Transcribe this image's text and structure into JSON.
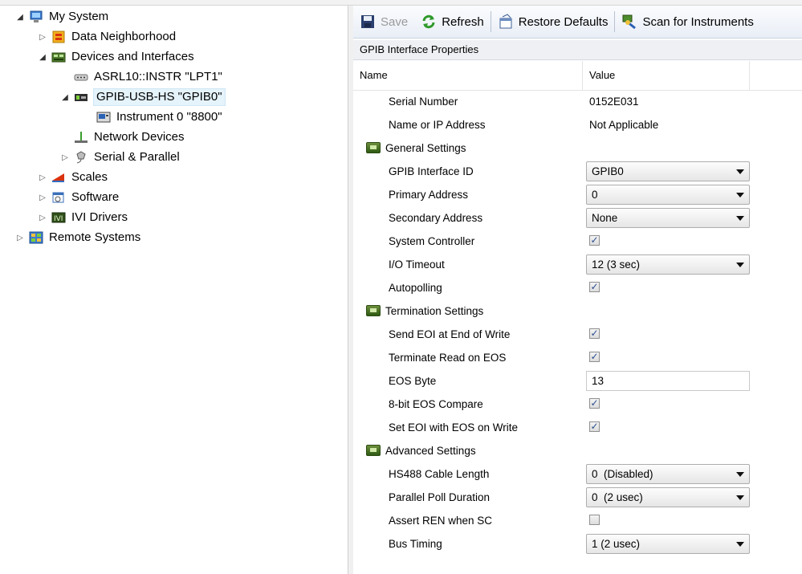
{
  "tree": {
    "nodes": [
      {
        "label": "My System",
        "arrow": "open",
        "icon": "computer-icon"
      },
      {
        "label": "Data Neighborhood",
        "arrow": "closed",
        "icon": "data-neighborhood-icon"
      },
      {
        "label": "Devices and Interfaces",
        "arrow": "open",
        "icon": "devices-icon"
      },
      {
        "label": "ASRL10::INSTR \"LPT1\"",
        "arrow": "none",
        "icon": "port-icon"
      },
      {
        "label": "GPIB-USB-HS \"GPIB0\"",
        "arrow": "open",
        "icon": "gpib-icon"
      },
      {
        "label": "Instrument 0 \"8800\"",
        "arrow": "none",
        "icon": "instrument-icon"
      },
      {
        "label": "Network Devices",
        "arrow": "none",
        "icon": "network-devices-icon"
      },
      {
        "label": "Serial & Parallel",
        "arrow": "closed",
        "icon": "serial-parallel-icon"
      },
      {
        "label": "Scales",
        "arrow": "closed",
        "icon": "scales-icon"
      },
      {
        "label": "Software",
        "arrow": "closed",
        "icon": "software-icon"
      },
      {
        "label": "IVI Drivers",
        "arrow": "closed",
        "icon": "ivi-drivers-icon"
      },
      {
        "label": "Remote Systems",
        "arrow": "closed",
        "icon": "remote-systems-icon"
      }
    ]
  },
  "toolbar": {
    "save_label": "Save",
    "refresh_label": "Refresh",
    "restore_label": "Restore Defaults",
    "scan_label": "Scan for Instruments"
  },
  "panel": {
    "title": "GPIB Interface Properties",
    "col_name": "Name",
    "col_value": "Value"
  },
  "properties": [
    {
      "kind": "text",
      "name": "Serial Number",
      "value": "0152E031"
    },
    {
      "kind": "text",
      "name": "Name or IP Address",
      "value": "Not Applicable"
    },
    {
      "kind": "group",
      "name": "General Settings"
    },
    {
      "kind": "dropdown",
      "name": "GPIB Interface ID",
      "value": "GPIB0"
    },
    {
      "kind": "dropdown",
      "name": "Primary Address",
      "value": "0"
    },
    {
      "kind": "dropdown",
      "name": "Secondary Address",
      "value": "None"
    },
    {
      "kind": "checkbox",
      "name": "System Controller",
      "checked": true
    },
    {
      "kind": "dropdown",
      "name": "I/O Timeout",
      "value": "12 (3 sec)"
    },
    {
      "kind": "checkbox",
      "name": "Autopolling",
      "checked": true
    },
    {
      "kind": "group",
      "name": "Termination Settings"
    },
    {
      "kind": "checkbox",
      "name": "Send EOI at End of Write",
      "checked": true
    },
    {
      "kind": "checkbox",
      "name": "Terminate Read on EOS",
      "checked": true
    },
    {
      "kind": "textbox",
      "name": "EOS Byte",
      "value": "13"
    },
    {
      "kind": "checkbox",
      "name": "8-bit EOS Compare",
      "checked": true
    },
    {
      "kind": "checkbox",
      "name": "Set EOI with EOS on Write",
      "checked": true
    },
    {
      "kind": "group",
      "name": "Advanced Settings"
    },
    {
      "kind": "dropdown",
      "name": "HS488 Cable Length",
      "value": "0  (Disabled)"
    },
    {
      "kind": "dropdown",
      "name": "Parallel Poll Duration",
      "value": "0  (2 usec)"
    },
    {
      "kind": "checkbox",
      "name": "Assert REN when SC",
      "checked": false
    },
    {
      "kind": "dropdown",
      "name": "Bus Timing",
      "value": "1 (2 usec)"
    }
  ]
}
